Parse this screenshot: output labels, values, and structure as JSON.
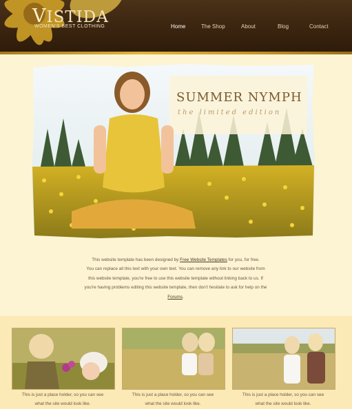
{
  "brand": {
    "first_letter": "V",
    "rest": "ISTIDA",
    "tagline": "WOMEN'S BEST CLOTHING"
  },
  "nav": [
    "Home",
    "The Shop",
    "About",
    "Blog",
    "Contact"
  ],
  "hero": {
    "title": "SUMMER NYMPH",
    "subtitle": "the limited edition"
  },
  "intro": {
    "lines": [
      "This website template has been designed by",
      "for you, for free.",
      "You can replace all this text with your own text. You can remove any link to our website from",
      "this website template, you're free to use this website template without linking back to us. If",
      "you're having problems editing this website template, then don't hesitate to ask for help on the"
    ],
    "link_templates": "Free Website Templates",
    "link_forums": "Forums",
    "end": "."
  },
  "features": [
    {
      "caption1": "This is just a place holder, so you can see",
      "caption2": "what the site would look like."
    },
    {
      "caption1": "This is just a place holder, so you can see",
      "caption2": "what the site would look like."
    },
    {
      "caption1": "This is just a place holder, so you can see",
      "caption2": "what the site would look like."
    }
  ],
  "colors": {
    "header": "#3a240f",
    "accent": "#e0b43d",
    "page_bg": "#fdf4d3",
    "band_bg": "#fbe9b6",
    "text": "#6a5840"
  }
}
